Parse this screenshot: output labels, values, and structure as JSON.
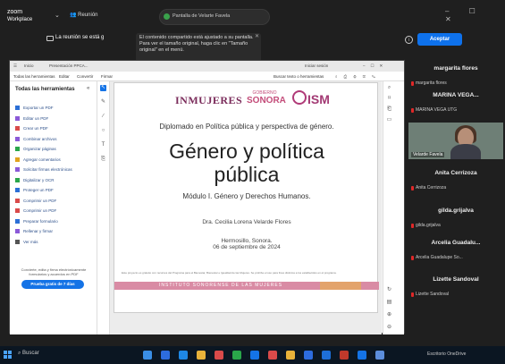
{
  "zoom": {
    "app_name": "zoom",
    "app_sub": "Workplace",
    "meeting_label": "Reunión",
    "share_pill": "Pantalla de Velarte Favela",
    "rec_notice": "La reunión se está g",
    "tooltip": "El contenido compartido está ajustado a su pantalla. Para ver el tamaño original, haga clic en \"Tamaño original\" en el menú.",
    "accept_label": "Aceptar",
    "window_controls": "– ☐ ✕"
  },
  "acrobat": {
    "tab_label": "Inicio",
    "tab_file": "Presentación PPCA...",
    "signin": "Iniciar sesión",
    "menu": [
      "Todas las herramientas",
      "Editar",
      "Convertir",
      "Firmar"
    ],
    "search_tools": "Buscar texto o herramientas",
    "panel_title": "Todas las herramientas",
    "tools": [
      {
        "label": "Exportar un PDF",
        "color": "#2b6fd6"
      },
      {
        "label": "Editar un PDF",
        "color": "#8b59d8"
      },
      {
        "label": "Crear un PDF",
        "color": "#d94a4a"
      },
      {
        "label": "Combinar archivos",
        "color": "#8b59d8"
      },
      {
        "label": "Organizar páginas",
        "color": "#2aa64a"
      },
      {
        "label": "Agregar comentarios",
        "color": "#e1a21d"
      },
      {
        "label": "Solicitar firmas electrónicas",
        "color": "#8b59d8"
      },
      {
        "label": "Digitalizar y OCR",
        "color": "#2aa64a"
      },
      {
        "label": "Proteger un PDF",
        "color": "#2b6fd6"
      },
      {
        "label": "Comprimir un PDF",
        "color": "#d94a4a"
      },
      {
        "label": "Comprimir un PDF",
        "color": "#d94a4a"
      },
      {
        "label": "Preparar formulario",
        "color": "#2b6fd6"
      },
      {
        "label": "Rellenar y firmar",
        "color": "#8b59d8"
      },
      {
        "label": "Ver más",
        "color": "#555555"
      }
    ],
    "trial_note": "Convierte, edita y firma electrónicamente formularios y acuerdos en PDF",
    "trial_button": "Prueba gratis de 7 días"
  },
  "slide": {
    "logo_inmujeres": "INMUJERES",
    "logo_sonora_top": "GOBIERNO",
    "logo_sonora": "SONORA",
    "logo_ism": "ISM",
    "diploma": "Diplomado en Política pública y perspectiva de género.",
    "title_line1": "Género y política",
    "title_line2": "pública",
    "module": "Módulo I. Género y Derechos Humanos.",
    "presenter": "Dra. Cecilia Lorena Velarde Flores",
    "place": "Hermosillo, Sonora.",
    "date": "06 de septiembre de 2024",
    "fine_print": "Este proyecto es gratuito con recursos del Programa para el Bienestar, Bienestar e Igualdad de las Mujeres. Se prohíbe el uso para fines distintos a los establecidos en el programa.",
    "stripe_text": "INSTITUTO SONORENSE DE LAS MUJERES"
  },
  "participants": [
    {
      "name": "margarita flores",
      "label": "margarita flores"
    },
    {
      "name": "MARINA VEGA...",
      "label": "MARINA VEGA UTG"
    },
    {
      "name": "Anita Cerrizoza",
      "label": "Anita Cerrizoza"
    },
    {
      "name": "gilda.grijalva",
      "label": "gilda.grijalva"
    },
    {
      "name": "Arcelia Guadalu...",
      "label": "Arcelia Guadalupe So..."
    },
    {
      "name": "Lizette Sandoval",
      "label": "Lizette Sandoval"
    }
  ],
  "video_label": "Velarde Favela",
  "taskbar": {
    "search": "Buscar",
    "tray": "Escritorio  OneDrive"
  }
}
